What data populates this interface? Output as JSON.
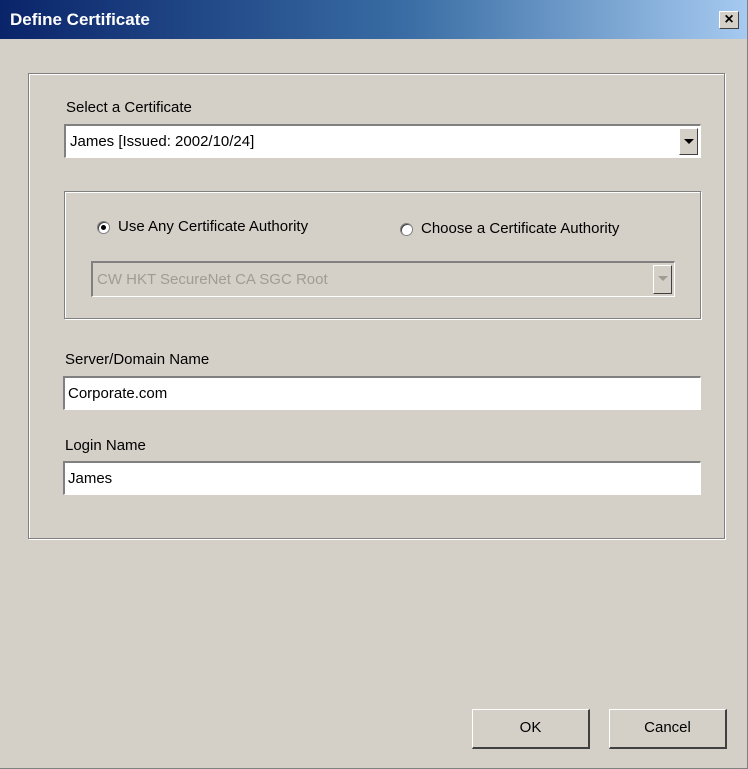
{
  "window": {
    "title": "Define Certificate",
    "close_glyph": "×"
  },
  "certificate": {
    "label": "Select a Certificate",
    "selected": "James   [Issued: 2002/10/24]"
  },
  "authority": {
    "use_any_label": "Use Any Certificate Authority",
    "use_any_selected": true,
    "choose_label": "Choose a Certificate Authority",
    "choose_selected": false,
    "ca_selected": "CW HKT SecureNet CA SGC Root",
    "ca_enabled": false
  },
  "server": {
    "label": "Server/Domain Name",
    "value": "Corporate.com"
  },
  "login": {
    "label": "Login Name",
    "value": "James"
  },
  "buttons": {
    "ok": "OK",
    "cancel": "Cancel"
  },
  "colors": {
    "title_gradient_start": "#0a246a",
    "title_gradient_end": "#a6caf0",
    "dialog_bg": "#d4d0c8"
  }
}
